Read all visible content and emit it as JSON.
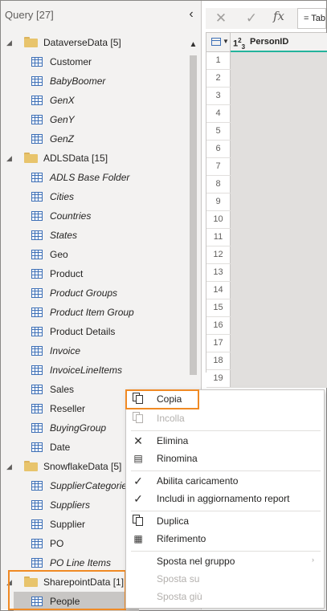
{
  "query_pane": {
    "title": "Query [27]",
    "collapse_glyph": "‹",
    "groups": [
      {
        "label": "DataverseData [5]",
        "items": [
          {
            "label": "Customer",
            "italic": false
          },
          {
            "label": "BabyBoomer",
            "italic": true
          },
          {
            "label": "GenX",
            "italic": true
          },
          {
            "label": "GenY",
            "italic": true
          },
          {
            "label": "GenZ",
            "italic": true
          }
        ]
      },
      {
        "label": "ADLSData [15]",
        "items": [
          {
            "label": "ADLS Base Folder",
            "italic": true
          },
          {
            "label": "Cities",
            "italic": true
          },
          {
            "label": "Countries",
            "italic": true
          },
          {
            "label": "States",
            "italic": true
          },
          {
            "label": "Geo",
            "italic": false
          },
          {
            "label": "Product",
            "italic": false
          },
          {
            "label": "Product Groups",
            "italic": true
          },
          {
            "label": "Product Item Group",
            "italic": true
          },
          {
            "label": "Product Details",
            "italic": false
          },
          {
            "label": "Invoice",
            "italic": true
          },
          {
            "label": "InvoiceLineItems",
            "italic": true
          },
          {
            "label": "Sales",
            "italic": false
          },
          {
            "label": "Reseller",
            "italic": false
          },
          {
            "label": "BuyingGroup",
            "italic": true
          },
          {
            "label": "Date",
            "italic": false
          }
        ]
      },
      {
        "label": "SnowflakeData [5]",
        "items": [
          {
            "label": "SupplierCategories",
            "italic": true
          },
          {
            "label": "Suppliers",
            "italic": true
          },
          {
            "label": "Supplier",
            "italic": false
          },
          {
            "label": "PO",
            "italic": false
          },
          {
            "label": "PO Line Items",
            "italic": true
          }
        ]
      },
      {
        "label": "SharepointData [1]",
        "items": [
          {
            "label": "People",
            "italic": false,
            "selected": true
          }
        ]
      }
    ]
  },
  "formula_bar": {
    "cancel_glyph": "✕",
    "confirm_glyph": "✓",
    "fx_label": "fx",
    "formula_text": "= Table"
  },
  "grid": {
    "column_type": "123",
    "column_name": "PersonID",
    "row_numbers": [
      "1",
      "2",
      "3",
      "4",
      "5",
      "6",
      "7",
      "8",
      "9",
      "10",
      "11",
      "12",
      "13",
      "14",
      "15",
      "16",
      "17",
      "18",
      "19"
    ]
  },
  "context_menu": {
    "copy": "Copia",
    "paste": "Incolla",
    "delete": "Elimina",
    "rename": "Rinomina",
    "enable_load": "Abilita caricamento",
    "include_refresh": "Includi in aggiornamento report",
    "duplicate": "Duplica",
    "reference": "Riferimento",
    "move_to_group": "Sposta nel gruppo",
    "move_up": "Sposta su",
    "move_down": "Sposta giù"
  },
  "colors": {
    "highlight_box": "#f08a24",
    "column_accent": "#23b39b",
    "table_icon": "#3d6fb6",
    "folder": "#e8c46c"
  }
}
